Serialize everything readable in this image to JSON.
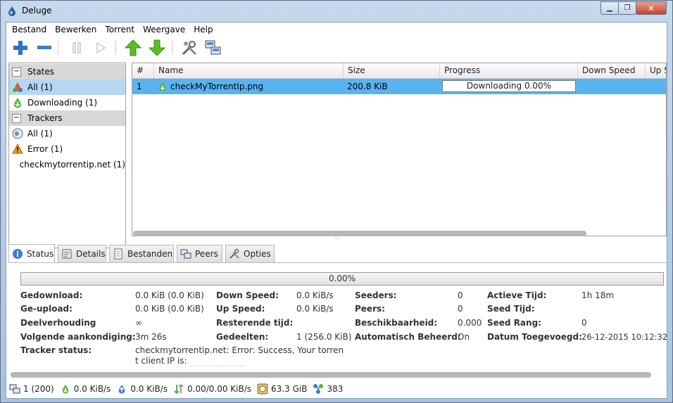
{
  "window": {
    "title": "Deluge"
  },
  "menu": [
    "Bestand",
    "Bewerken",
    "Torrent",
    "Weergave",
    "Help"
  ],
  "sidebar": {
    "states_header": "States",
    "states": [
      {
        "label": "All (1)",
        "icon": "all-states-icon"
      },
      {
        "label": "Downloading (1)",
        "icon": "downloading-icon"
      }
    ],
    "trackers_header": "Trackers",
    "trackers": [
      {
        "label": "All (1)",
        "icon": "globe-icon"
      },
      {
        "label": "Error (1)",
        "icon": "warning-icon"
      },
      {
        "label": "checkmytorrentip.net (1)",
        "icon": ""
      }
    ]
  },
  "columns": [
    "#",
    "Name",
    "Size",
    "Progress",
    "Down Speed",
    "Up Sp"
  ],
  "torrents": [
    {
      "num": "1",
      "name": "checkMyTorrentIp.png",
      "size": "200.8 KiB",
      "progress_text": "Downloading 0.00%",
      "progress": 0.0
    }
  ],
  "tabs": [
    "Status",
    "Details",
    "Bestanden",
    "Peers",
    "Opties"
  ],
  "status_panel": {
    "progress_text": "0.00%",
    "progress": 0.0,
    "col1": [
      {
        "label": "Gedownload:",
        "value": "0.0 KiB (0.0 KiB)"
      },
      {
        "label": "Ge-upload:",
        "value": "0.0 KiB (0.0 KiB)"
      },
      {
        "label": "Deelverhouding",
        "value": "∞"
      },
      {
        "label": "Volgende aankondiging:",
        "value": "3m 26s"
      },
      {
        "label": "Tracker status:",
        "value": "checkmytorrentip.net: Error: Success, Your torren"
      }
    ],
    "tracker_status_line2": "t client IP is: ",
    "col2": [
      {
        "label": "Down Speed:",
        "value": "0.0 KiB/s"
      },
      {
        "label": "Up Speed:",
        "value": "0.0 KiB/s"
      },
      {
        "label": "Resterende tijd:",
        "value": ""
      },
      {
        "label": "Gedeelten:",
        "value": "1 (256.0 KiB)"
      }
    ],
    "col3": [
      {
        "label": "Seeders:",
        "value": "0"
      },
      {
        "label": "Peers:",
        "value": "0"
      },
      {
        "label": "Beschikbaarheid:",
        "value": "0.000"
      },
      {
        "label": "Automatisch Beheerd:",
        "value": "On"
      }
    ],
    "col4": [
      {
        "label": "Actieve Tijd:",
        "value": "1h 18m"
      },
      {
        "label": "Seed Tijd:",
        "value": ""
      },
      {
        "label": "Seed Rang:",
        "value": "0"
      },
      {
        "label": "Datum Toegevoegd:",
        "value": "26-12-2015 10:12:32"
      }
    ]
  },
  "statusbar": {
    "connections": "1 (200)",
    "down": "0.0 KiB/s",
    "up": "0.0 KiB/s",
    "protocol": "0.00/0.00 KiB/s",
    "free_space": "63.3 GiB",
    "dht": "383"
  }
}
